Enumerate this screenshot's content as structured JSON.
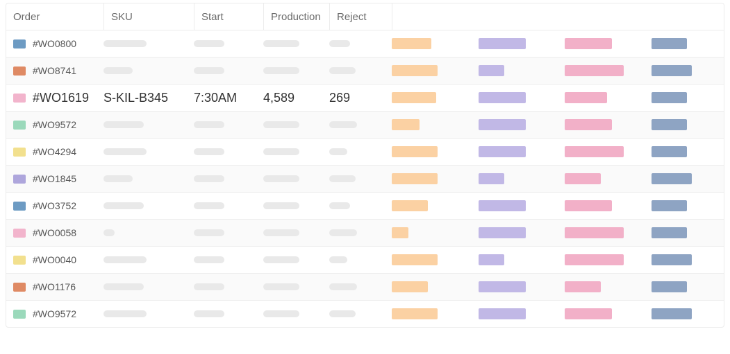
{
  "headers": {
    "order": "Order",
    "sku": "SKU",
    "start": "Start",
    "production": "Production",
    "reject": "Reject"
  },
  "swatch_colors": {
    "blue": "#6d9bc3",
    "orange": "#df8a64",
    "pink": "#f2b4cc",
    "mint": "#9bd9bb",
    "yellow": "#f2e08e",
    "lavender": "#aea6dc"
  },
  "bar_colors": {
    "orange": "#fbd1a3",
    "lavender": "#c1b8e6",
    "pink": "#f2b0c8",
    "blue": "#8ea4c3"
  },
  "skeleton_widths": {
    "sku": 62,
    "start": 44,
    "prod": 52,
    "rej": 30
  },
  "rows": [
    {
      "swatch": "blue",
      "order_id": "#WO0800",
      "stripe": false,
      "highlight": false,
      "sku_w": 62,
      "rej_w": 30,
      "bars": [
        60,
        72,
        72,
        55
      ]
    },
    {
      "swatch": "orange",
      "order_id": "#WO8741",
      "stripe": true,
      "highlight": false,
      "sku_w": 42,
      "rej_w": 38,
      "bars": [
        70,
        40,
        90,
        62
      ]
    },
    {
      "swatch": "pink",
      "order_id": "#WO1619",
      "stripe": false,
      "highlight": true,
      "sku": "S-KIL-B345",
      "start": "7:30AM",
      "production": "4,589",
      "reject": "269",
      "bars": [
        68,
        72,
        65,
        55
      ]
    },
    {
      "swatch": "mint",
      "order_id": "#WO9572",
      "stripe": true,
      "highlight": false,
      "sku_w": 58,
      "rej_w": 40,
      "bars": [
        42,
        72,
        72,
        55
      ]
    },
    {
      "swatch": "yellow",
      "order_id": "#WO4294",
      "stripe": false,
      "highlight": false,
      "sku_w": 62,
      "rej_w": 26,
      "bars": [
        70,
        72,
        90,
        55
      ]
    },
    {
      "swatch": "lavender",
      "order_id": "#WO1845",
      "stripe": true,
      "highlight": false,
      "sku_w": 42,
      "rej_w": 38,
      "bars": [
        70,
        40,
        55,
        62
      ]
    },
    {
      "swatch": "blue",
      "order_id": "#WO3752",
      "stripe": false,
      "highlight": false,
      "sku_w": 58,
      "rej_w": 30,
      "bars": [
        55,
        72,
        72,
        55
      ]
    },
    {
      "swatch": "pink",
      "order_id": "#WO0058",
      "stripe": true,
      "highlight": false,
      "sku_w": 16,
      "rej_w": 40,
      "bars": [
        25,
        72,
        90,
        55
      ]
    },
    {
      "swatch": "yellow",
      "order_id": "#WO0040",
      "stripe": false,
      "highlight": false,
      "sku_w": 62,
      "rej_w": 26,
      "bars": [
        70,
        40,
        90,
        62
      ]
    },
    {
      "swatch": "orange",
      "order_id": "#WO1176",
      "stripe": true,
      "highlight": false,
      "sku_w": 58,
      "rej_w": 40,
      "bars": [
        55,
        72,
        55,
        55
      ]
    },
    {
      "swatch": "mint",
      "order_id": "#WO9572",
      "stripe": false,
      "highlight": false,
      "sku_w": 62,
      "rej_w": 38,
      "bars": [
        70,
        72,
        72,
        62
      ]
    }
  ]
}
